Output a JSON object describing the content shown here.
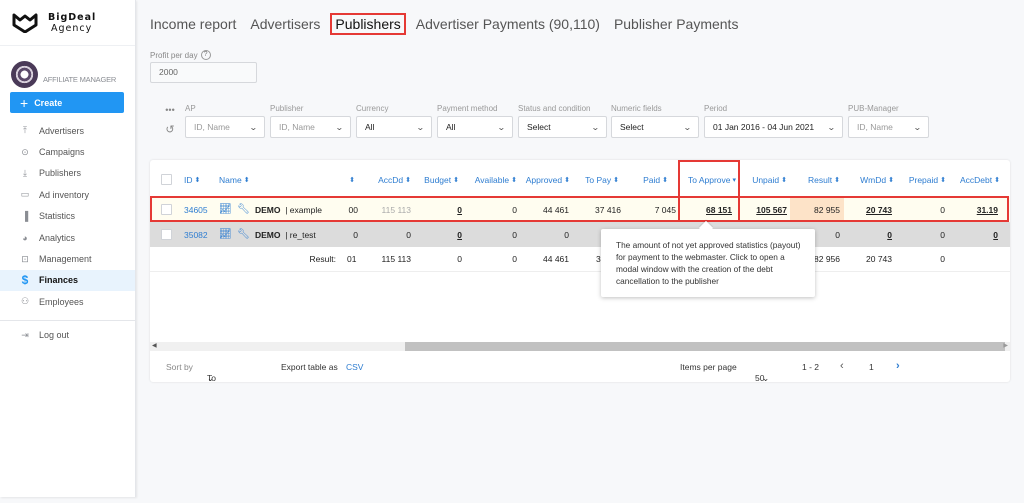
{
  "brand": {
    "name_line1": "BigDeal",
    "name_line2": "Agency"
  },
  "user": {
    "role": "AFFILIATE MANAGER"
  },
  "sidebar": {
    "create_label": "Create",
    "items": [
      {
        "label": "Advertisers",
        "icon": "upload-icon"
      },
      {
        "label": "Campaigns",
        "icon": "play-circle-icon"
      },
      {
        "label": "Publishers",
        "icon": "download-icon"
      },
      {
        "label": "Ad inventory",
        "icon": "window-icon"
      },
      {
        "label": "Statistics",
        "icon": "bar-chart-icon"
      },
      {
        "label": "Analytics",
        "icon": "pie-chart-icon"
      },
      {
        "label": "Management",
        "icon": "settings-box-icon"
      },
      {
        "label": "Finances",
        "icon": "dollar-icon",
        "active": true
      },
      {
        "label": "Employees",
        "icon": "people-icon"
      }
    ],
    "logout_label": "Log out"
  },
  "tabs": [
    {
      "label": "Income report"
    },
    {
      "label": "Advertisers"
    },
    {
      "label": "Publishers",
      "active": true
    },
    {
      "label": "Advertiser Payments (90,110)"
    },
    {
      "label": "Publisher Payments"
    }
  ],
  "profit_per_day": {
    "label": "Profit per day",
    "value": "2000"
  },
  "filters": {
    "ap": {
      "label": "AP",
      "placeholder": "ID, Name"
    },
    "publisher": {
      "label": "Publisher",
      "placeholder": "ID, Name"
    },
    "currency": {
      "label": "Currency",
      "value": "All"
    },
    "payment_method": {
      "label": "Payment method",
      "value": "All"
    },
    "status": {
      "label": "Status and condition",
      "value": "Select"
    },
    "numeric": {
      "label": "Numeric fields",
      "value": "Select"
    },
    "period": {
      "label": "Period",
      "value": "01 Jan 2016 - 04 Jun 2021"
    },
    "pub_manager": {
      "label": "PUB-Manager",
      "placeholder": "ID, Name"
    }
  },
  "table": {
    "columns": {
      "id": "ID",
      "name": "Name",
      "blank": "",
      "accdd": "AccDd",
      "budget": "Budget",
      "available": "Available",
      "approved": "Approved",
      "topay": "To Pay",
      "paid": "Paid",
      "toapprove": "To Approve",
      "unpaid": "Unpaid",
      "result": "Result",
      "wmdd": "WmDd",
      "prepaid": "Prepaid",
      "accdebt": "AccDebt"
    },
    "rows": [
      {
        "id": "34605",
        "name_bold": "DEMO",
        "name": "| example",
        "blank": "00",
        "accdd": "115 113",
        "budget": "0",
        "available": "0",
        "approved": "44 461",
        "topay": "37 416",
        "paid": "7 045",
        "toapprove": "68 151",
        "unpaid": "105 567",
        "result": "82 955",
        "wmdd": "20 743",
        "prepaid": "0",
        "accdebt": "31.19"
      },
      {
        "id": "35082",
        "name_bold": "DEMO",
        "name": "| re_test",
        "blank": "0",
        "accdd": "0",
        "budget": "0",
        "available": "0",
        "approved": "0",
        "topay": "",
        "paid": "",
        "toapprove": "",
        "unpaid": "",
        "result": "0",
        "wmdd": "0",
        "prepaid": "0",
        "accdebt": "0"
      }
    ],
    "totals": {
      "label": "Result:",
      "blank": "01",
      "accdd": "115 113",
      "budget": "0",
      "available": "0",
      "approved": "44 461",
      "topay": "3",
      "result": "82 956",
      "wmdd": "20 743",
      "prepaid": "0"
    }
  },
  "tooltip": {
    "text": "The amount of not yet approved statistics (payout) for payment to the webmaster. Click to open a modal window with the creation of the debt cancellation to the publisher"
  },
  "footer": {
    "sort_by_label": "Sort by",
    "sort_by_value": "To Approve",
    "export_label": "Export table as",
    "export_format": "CSV",
    "items_per_page_label": "Items per page",
    "items_per_page": "50",
    "range": "1 - 2",
    "page": "1"
  },
  "colors": {
    "accent": "#2196f3",
    "link": "#2e7dd1",
    "highlight": "#e53935"
  }
}
